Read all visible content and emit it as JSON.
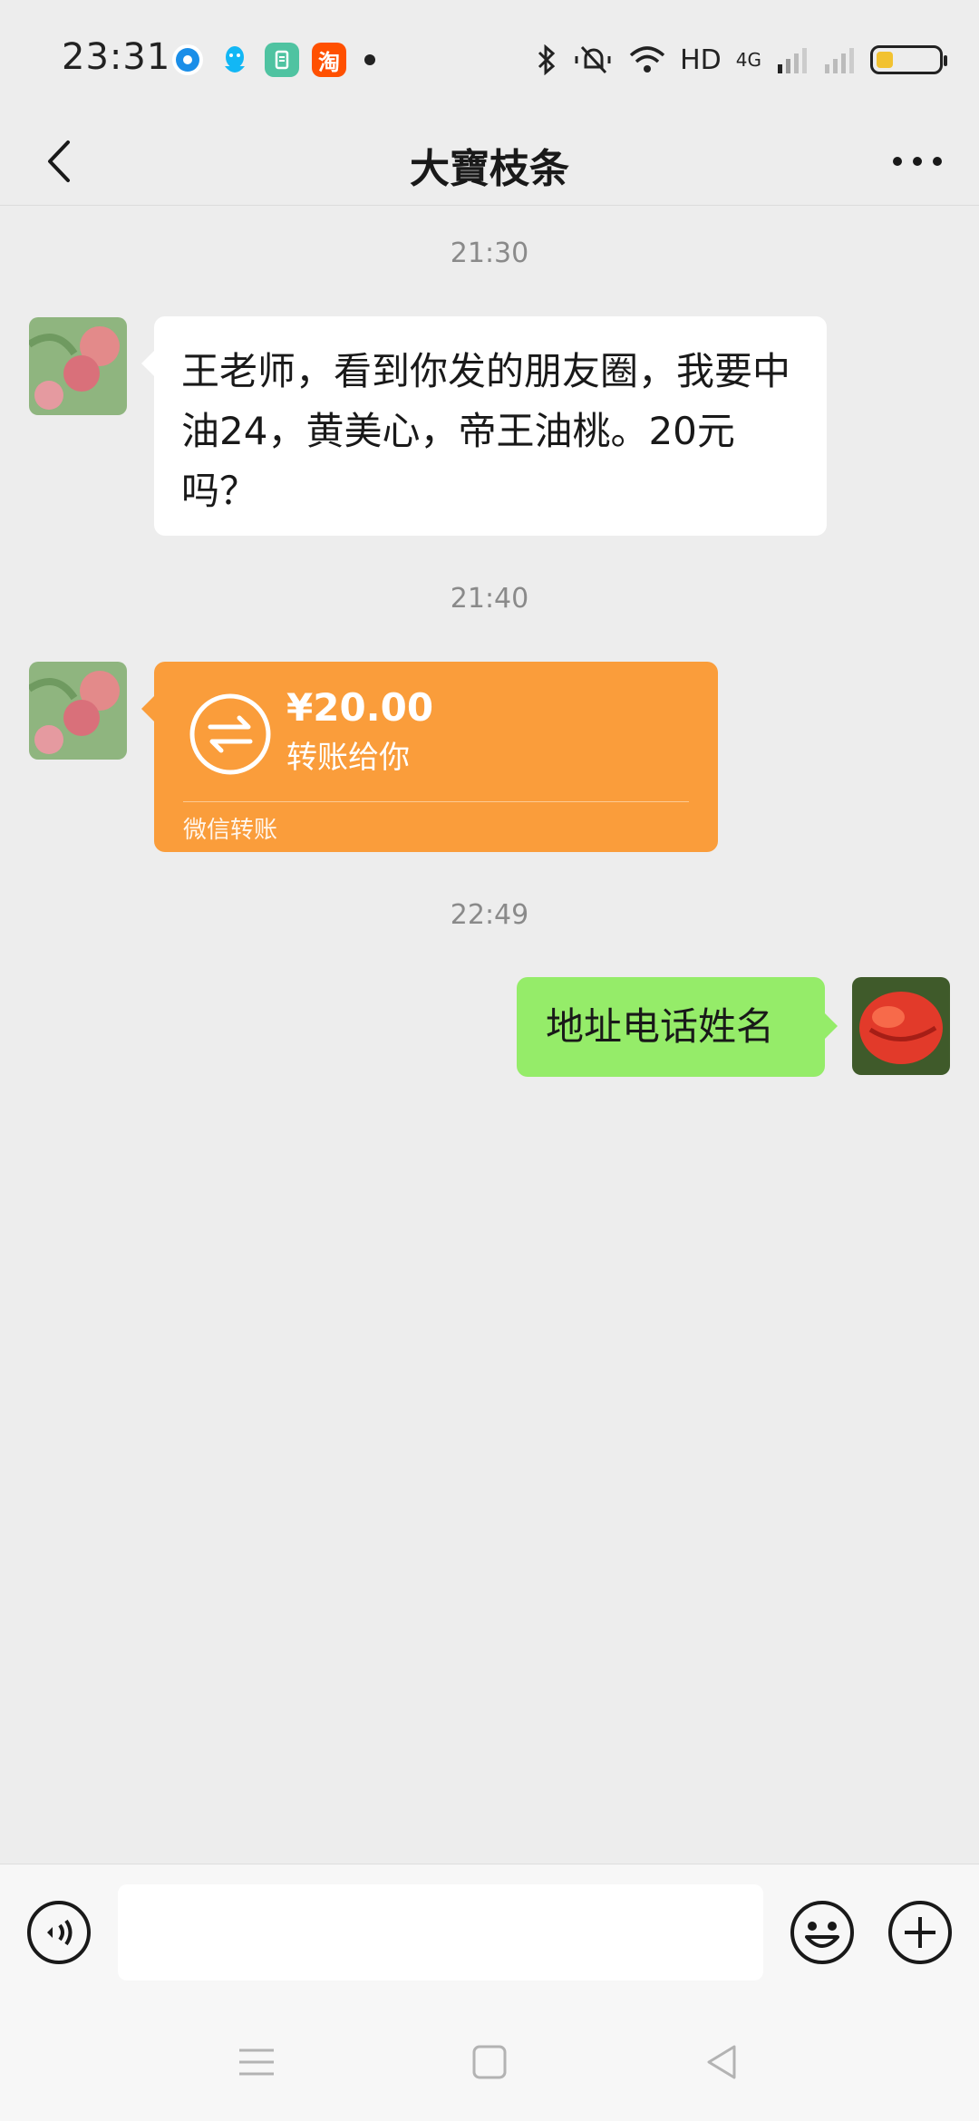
{
  "status_bar": {
    "time": "23:31",
    "network": "HD",
    "signal_label": "4G",
    "app_icons": [
      "browser-icon",
      "qq-icon",
      "app-store-icon",
      "taobao-icon"
    ],
    "taobao_char": "淘"
  },
  "header": {
    "title": "大寶枝条"
  },
  "messages": [
    {
      "type": "timestamp",
      "text": "21:30"
    },
    {
      "type": "text",
      "direction": "incoming",
      "text": "王老师，看到你发的朋友圈，我要中油24，黄美心，帝王油桃。20元吗？"
    },
    {
      "type": "timestamp",
      "text": "21:40"
    },
    {
      "type": "transfer",
      "direction": "incoming",
      "amount": "¥20.00",
      "label": "转账给你",
      "footer": "微信转账"
    },
    {
      "type": "timestamp",
      "text": "22:49"
    },
    {
      "type": "text",
      "direction": "outgoing",
      "text": "地址电话姓名"
    }
  ],
  "colors": {
    "background": "#ededed",
    "incoming_bubble": "#ffffff",
    "outgoing_bubble": "#95ec69",
    "transfer_bubble": "#fa9d3b"
  },
  "input": {
    "value": ""
  }
}
